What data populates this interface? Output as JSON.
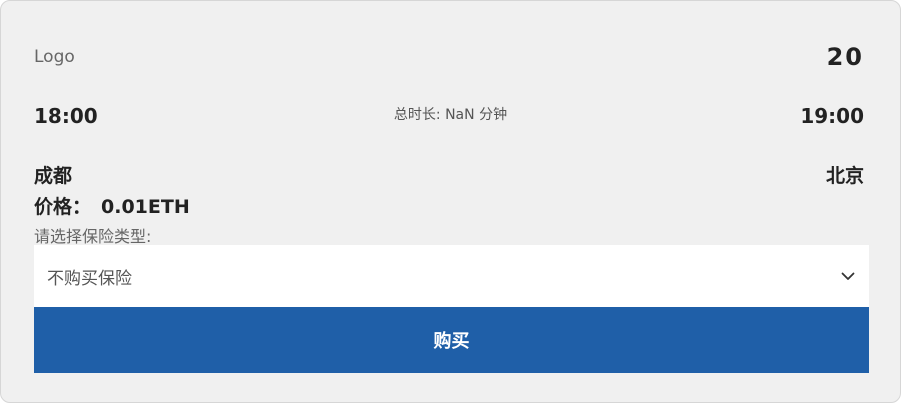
{
  "header": {
    "logo": "Logo",
    "flight_number": "20"
  },
  "times": {
    "departure": "18:00",
    "arrival": "19:00",
    "duration": "总时长: NaN 分钟"
  },
  "cities": {
    "from": "成都",
    "to": "北京"
  },
  "price": {
    "label": "价格：",
    "value": "0.01ETH"
  },
  "insurance": {
    "label": "请选择保险类型:",
    "selected": "不购买保险"
  },
  "buy_button": {
    "label": "购买"
  },
  "colors": {
    "card_background": "#f0f0f0",
    "buy_button": "#1f5fa8"
  },
  "icons": {
    "select_chevron": "chevron-down-icon"
  }
}
